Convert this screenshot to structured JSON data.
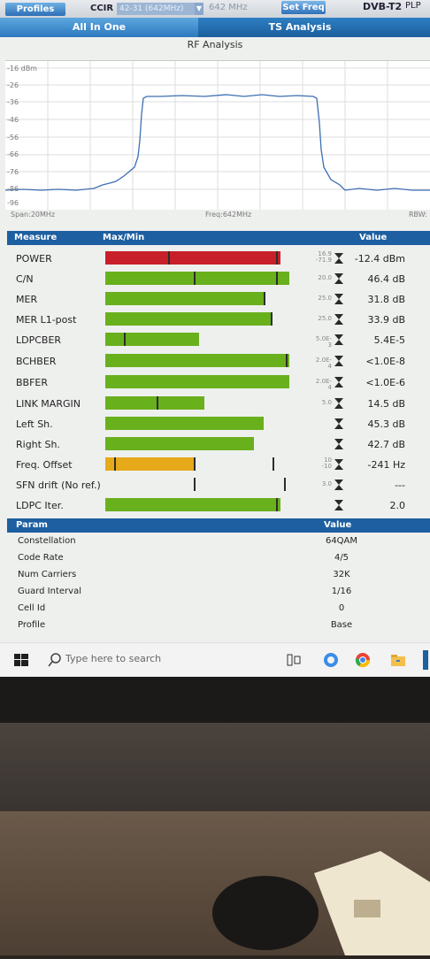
{
  "topbar": {
    "profiles_label": "Profiles",
    "standard": "CCIR",
    "channel": "42-31 (642MHz)",
    "freq": "642 MHz",
    "set_freq_label": "Set Freq",
    "mode": "DVB-T2",
    "plp_label": "PLP"
  },
  "tabs": [
    {
      "label": "All In One"
    },
    {
      "label": "TS Analysis"
    }
  ],
  "rf": {
    "title": "RF Analysis",
    "y_ticks": [
      "-16 dBm",
      "-26",
      "-36",
      "-46",
      "-56",
      "-66",
      "-76",
      "-86",
      "-96"
    ],
    "span": "Span:20MHz",
    "center": "Freq:642MHz",
    "rbw": "RBW:"
  },
  "measure": {
    "headers": {
      "measure": "Measure",
      "maxmin": "Max/Min",
      "value": "Value"
    },
    "rows": [
      {
        "name": "POWER",
        "value": "-12.4 dBm",
        "minmax": "16.9 -71.9",
        "fill": 0.95,
        "color": "#c8202a",
        "ticks": [
          0.34,
          0.93
        ]
      },
      {
        "name": "C/N",
        "value": "46.4 dB",
        "minmax": "20.0",
        "fill": 1.0,
        "color": "#69b01d",
        "ticks": [
          0.48,
          0.93
        ]
      },
      {
        "name": "MER",
        "value": "31.8 dB",
        "minmax": "25.0",
        "fill": 0.86,
        "color": "#69b01d",
        "ticks": [
          0.86
        ]
      },
      {
        "name": "MER L1-post",
        "value": "33.9 dB",
        "minmax": "25.0",
        "fill": 0.9,
        "color": "#69b01d",
        "ticks": [
          0.9
        ]
      },
      {
        "name": "LDPCBER",
        "value": "5.4E-5",
        "minmax": "5.0E-3",
        "fill": 0.51,
        "color": "#69b01d",
        "ticks": [
          0.1
        ]
      },
      {
        "name": "BCHBER",
        "value": "<1.0E-8",
        "minmax": "2.0E-4",
        "fill": 1.0,
        "color": "#69b01d",
        "ticks": [
          0.98
        ]
      },
      {
        "name": "BBFER",
        "value": "<1.0E-6",
        "minmax": "2.0E-4",
        "fill": 1.0,
        "color": "#69b01d",
        "ticks": []
      },
      {
        "name": "LINK MARGIN",
        "value": "14.5 dB",
        "minmax": "5.0",
        "fill": 0.54,
        "color": "#69b01d",
        "ticks": [
          0.28
        ]
      },
      {
        "name": "Left Sh.",
        "value": "45.3 dB",
        "minmax": "",
        "fill": 0.86,
        "color": "#69b01d",
        "ticks": []
      },
      {
        "name": "Right Sh.",
        "value": "42.7 dB",
        "minmax": "",
        "fill": 0.81,
        "color": "#69b01d",
        "ticks": []
      },
      {
        "name": "Freq. Offset",
        "value": "-241 Hz",
        "minmax": "10 -10",
        "fill": 0.48,
        "color": "#e6a91a",
        "ticks": [
          0.05,
          0.48,
          0.91
        ]
      },
      {
        "name": "SFN drift (No ref.)",
        "value": "---",
        "minmax": "3.0",
        "fill": 0.0,
        "color": "#69b01d",
        "ticks": [
          0.48,
          0.97
        ]
      },
      {
        "name": "LDPC Iter.",
        "value": "2.0",
        "minmax": "",
        "fill": 0.95,
        "color": "#69b01d",
        "ticks": [
          0.93
        ]
      }
    ]
  },
  "params": {
    "headers": {
      "param": "Param",
      "value": "Value"
    },
    "rows": [
      {
        "name": "Constellation",
        "value": "64QAM"
      },
      {
        "name": "Code Rate",
        "value": "4/5"
      },
      {
        "name": "Num Carriers",
        "value": "32K"
      },
      {
        "name": "Guard Interval",
        "value": "1/16"
      },
      {
        "name": "Cell Id",
        "value": "0"
      },
      {
        "name": "Profile",
        "value": "Base"
      }
    ]
  },
  "taskbar": {
    "search_placeholder": "Type here to search"
  }
}
